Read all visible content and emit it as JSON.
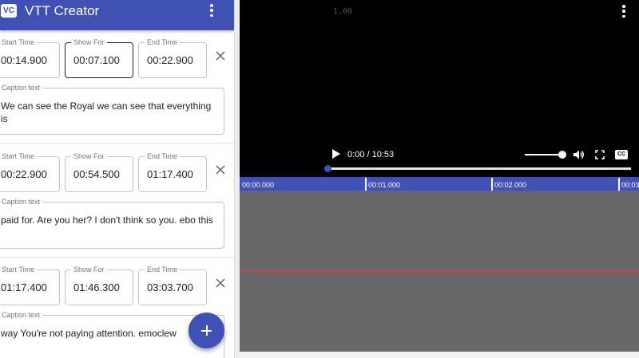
{
  "app": {
    "logo_text": "VC",
    "title": "VTT Creator",
    "accent_color": "#3f51b5"
  },
  "labels": {
    "start": "Start Time",
    "show": "Show For",
    "end": "End Time",
    "caption": "Caption text"
  },
  "entries": [
    {
      "start": "00:14.900",
      "show": "00:07.100",
      "end": "00:22.900",
      "caption": "We can see the Royal we can see that everything is"
    },
    {
      "start": "00:22.900",
      "show": "00:54.500",
      "end": "01:17.400",
      "caption": "paid for. Are you her? I don't think so you. ebo this"
    },
    {
      "start": "01:17.400",
      "show": "01:46.300",
      "end": "03:03.700",
      "caption": "way You're not paying attention. emoclew"
    }
  ],
  "player": {
    "playback_rate": "1.00",
    "time_display": "0:00 / 10:53",
    "cc_label": "CC",
    "progress": 0,
    "volume": 0.95
  },
  "timeline": {
    "marks": [
      "00:00.000",
      "00:01.000",
      "00:02.000",
      "00:03"
    ]
  },
  "icons": {
    "menu": "more-vert-icon",
    "close": "close-icon",
    "add": "add-icon",
    "play": "play-icon",
    "volume": "volume-icon",
    "fullscreen": "fullscreen-icon",
    "captions": "closed-captions-icon"
  }
}
